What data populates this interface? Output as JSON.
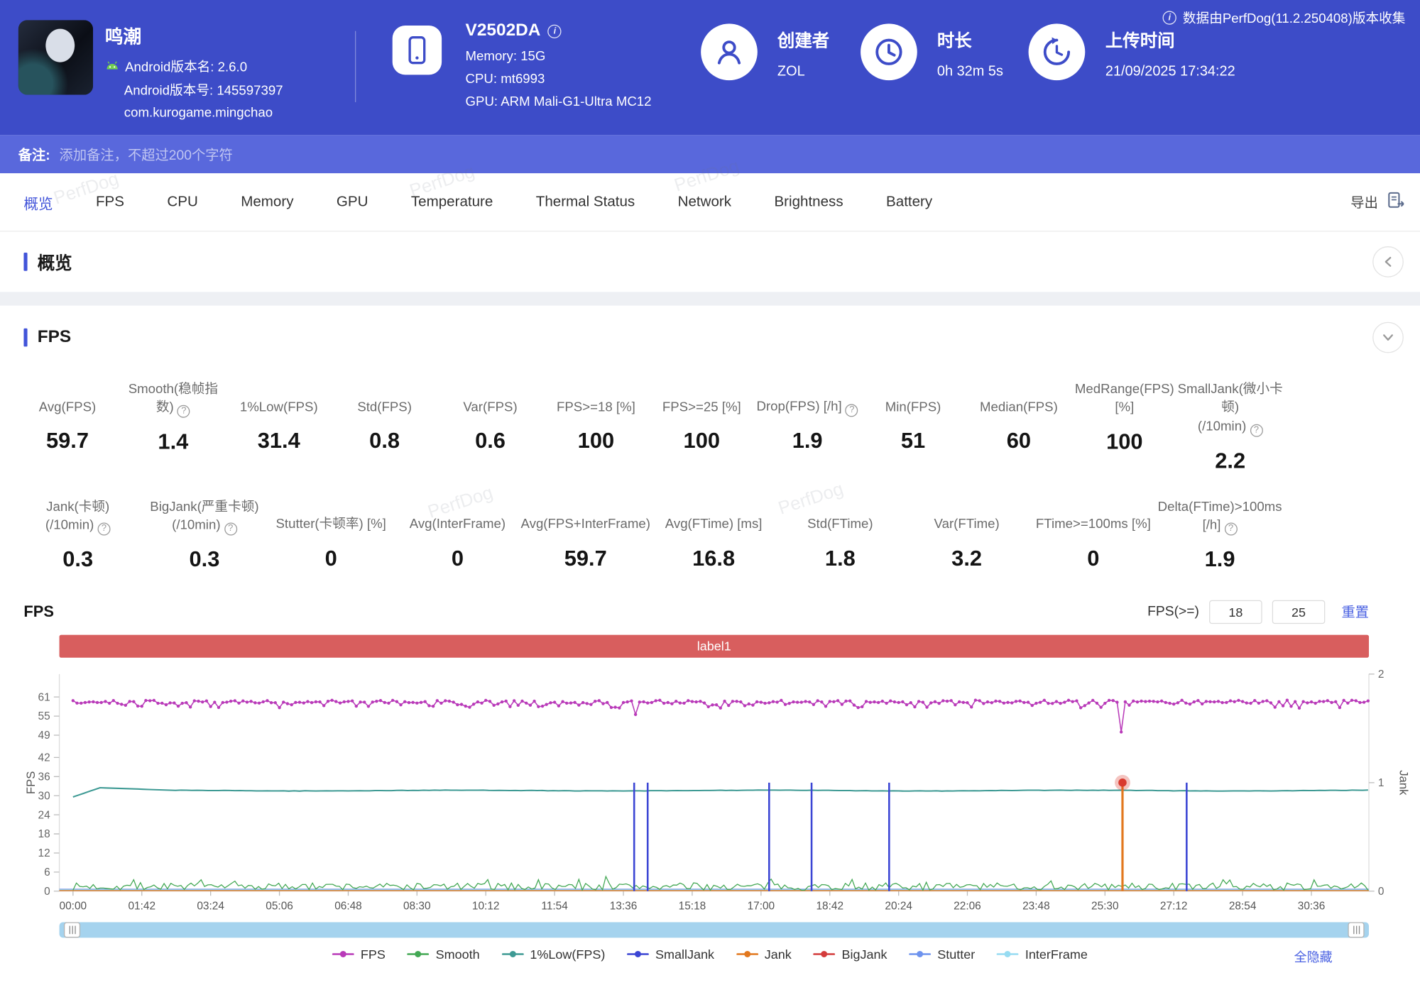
{
  "header": {
    "app": {
      "name": "鸣潮",
      "android_version_label": "Android版本名: 2.6.0",
      "android_build_label": "Android版本号: 145597397",
      "package": "com.kurogame.mingchao"
    },
    "device": {
      "model": "V2502DA",
      "memory": "Memory: 15G",
      "cpu": "CPU: mt6993",
      "gpu": "GPU: ARM Mali-G1-Ultra MC12"
    },
    "creator": {
      "label": "创建者",
      "value": "ZOL"
    },
    "duration": {
      "label": "时长",
      "value": "0h 32m 5s"
    },
    "upload": {
      "label": "上传时间",
      "value": "21/09/2025 17:34:22"
    },
    "collect_info": "数据由PerfDog(11.2.250408)版本收集"
  },
  "note_bar": {
    "label": "备注:",
    "placeholder": "添加备注，不超过200个字符"
  },
  "tabs": {
    "items": [
      {
        "label": "概览",
        "active": true
      },
      {
        "label": "FPS"
      },
      {
        "label": "CPU"
      },
      {
        "label": "Memory"
      },
      {
        "label": "GPU"
      },
      {
        "label": "Temperature"
      },
      {
        "label": "Thermal Status"
      },
      {
        "label": "Network"
      },
      {
        "label": "Brightness"
      },
      {
        "label": "Battery"
      }
    ],
    "export_label": "导出"
  },
  "overview": {
    "title": "概览"
  },
  "fps_section": {
    "title": "FPS",
    "chart_title": "FPS",
    "filter": {
      "label": "FPS(>=)",
      "input1": "18",
      "input2": "25",
      "reset": "重置"
    },
    "hide_all": "全隐藏",
    "stats_row1": [
      {
        "label": "Avg(FPS)",
        "value": "59.7"
      },
      {
        "label": "Smooth(稳帧指数)",
        "value": "1.4",
        "help": true
      },
      {
        "label": "1%Low(FPS)",
        "value": "31.4"
      },
      {
        "label": "Std(FPS)",
        "value": "0.8"
      },
      {
        "label": "Var(FPS)",
        "value": "0.6"
      },
      {
        "label": "FPS>=18 [%]",
        "value": "100"
      },
      {
        "label": "FPS>=25 [%]",
        "value": "100"
      },
      {
        "label": "Drop(FPS) [/h]",
        "value": "1.9",
        "help": true
      },
      {
        "label": "Min(FPS)",
        "value": "51"
      },
      {
        "label": "Median(FPS)",
        "value": "60"
      },
      {
        "label": "MedRange(FPS)[%]",
        "value": "100"
      },
      {
        "label": "SmallJank(微小卡顿)",
        "label2": "(/10min)",
        "value": "2.2",
        "help": true
      }
    ],
    "stats_row2": [
      {
        "label": "Jank(卡顿)",
        "label2": "(/10min)",
        "value": "0.3",
        "help": true
      },
      {
        "label": "BigJank(严重卡顿)",
        "label2": "(/10min)",
        "value": "0.3",
        "help": true
      },
      {
        "label": "Stutter(卡顿率) [%]",
        "value": "0"
      },
      {
        "label": "Avg(InterFrame)",
        "value": "0"
      },
      {
        "label": "Avg(FPS+InterFrame)",
        "value": "59.7"
      },
      {
        "label": "Avg(FTime) [ms]",
        "value": "16.8"
      },
      {
        "label": "Std(FTime)",
        "value": "1.8"
      },
      {
        "label": "Var(FTime)",
        "value": "3.2"
      },
      {
        "label": "FTime>=100ms [%]",
        "value": "0"
      },
      {
        "label": "Delta(FTime)>100ms [/h]",
        "value": "1.9",
        "help": true
      }
    ]
  },
  "chart_data": {
    "type": "line",
    "banner_label": "label1",
    "x_axis": {
      "tick_labels": [
        "00:00",
        "01:42",
        "03:24",
        "05:06",
        "06:48",
        "08:30",
        "10:12",
        "11:54",
        "13:36",
        "15:18",
        "17:00",
        "18:42",
        "20:24",
        "22:06",
        "23:48",
        "25:30",
        "27:12",
        "28:54",
        "30:36"
      ],
      "tick_interval_seconds": 102,
      "total_seconds": 1925
    },
    "y_left": {
      "label": "FPS",
      "tick_labels": [
        61,
        55,
        49,
        42,
        36,
        30,
        24,
        18,
        12,
        6,
        0
      ],
      "max": 68.2
    },
    "y_right": {
      "label": "Jank",
      "tick_labels": [
        2,
        1,
        0
      ],
      "max": 2
    },
    "series": [
      {
        "name": "FPS",
        "color": "#b93ab9",
        "type": "noisy-line",
        "baseline": 59.7,
        "min_dip": {
          "t": 1556,
          "value": 50
        },
        "secondary_dip": {
          "t": 835,
          "value": 55.5
        }
      },
      {
        "name": "Smooth",
        "color": "#43a854",
        "type": "noisy-line",
        "baseline": 1.4,
        "range": [
          0,
          4.6
        ]
      },
      {
        "name": "1%Low(FPS)",
        "color": "#3e9a94",
        "type": "line",
        "start": 29.6,
        "peak": 32.5,
        "settle": 31.6
      },
      {
        "name": "SmallJank",
        "color": "#3b45d4",
        "type": "spikes",
        "axis": "right",
        "spike_value": 1,
        "spike_times_seconds": [
          832,
          852,
          1032,
          1095,
          1210,
          1651
        ]
      },
      {
        "name": "Jank",
        "color": "#e2781e",
        "type": "spikes",
        "axis": "right",
        "spike_value": 1,
        "spike_times_seconds": [
          1556
        ],
        "marker": {
          "t": 1556,
          "value": 1,
          "color": "#d93a2e"
        }
      },
      {
        "name": "BigJank",
        "color": "#d43c3c",
        "type": "flat",
        "value": 0
      },
      {
        "name": "Stutter",
        "color": "#6e93ee",
        "type": "flat",
        "value": 0
      },
      {
        "name": "InterFrame",
        "color": "#97dcf2",
        "type": "flat",
        "value": 0
      }
    ]
  },
  "watermark": "PerfDog",
  "colors": {
    "header_bg": "#3d4cc8",
    "note_bg": "#5968dc",
    "accent": "#4254d9",
    "banner": "#d85e5e",
    "link": "#4a61e2",
    "scrollbar": "#a5d3ee"
  }
}
